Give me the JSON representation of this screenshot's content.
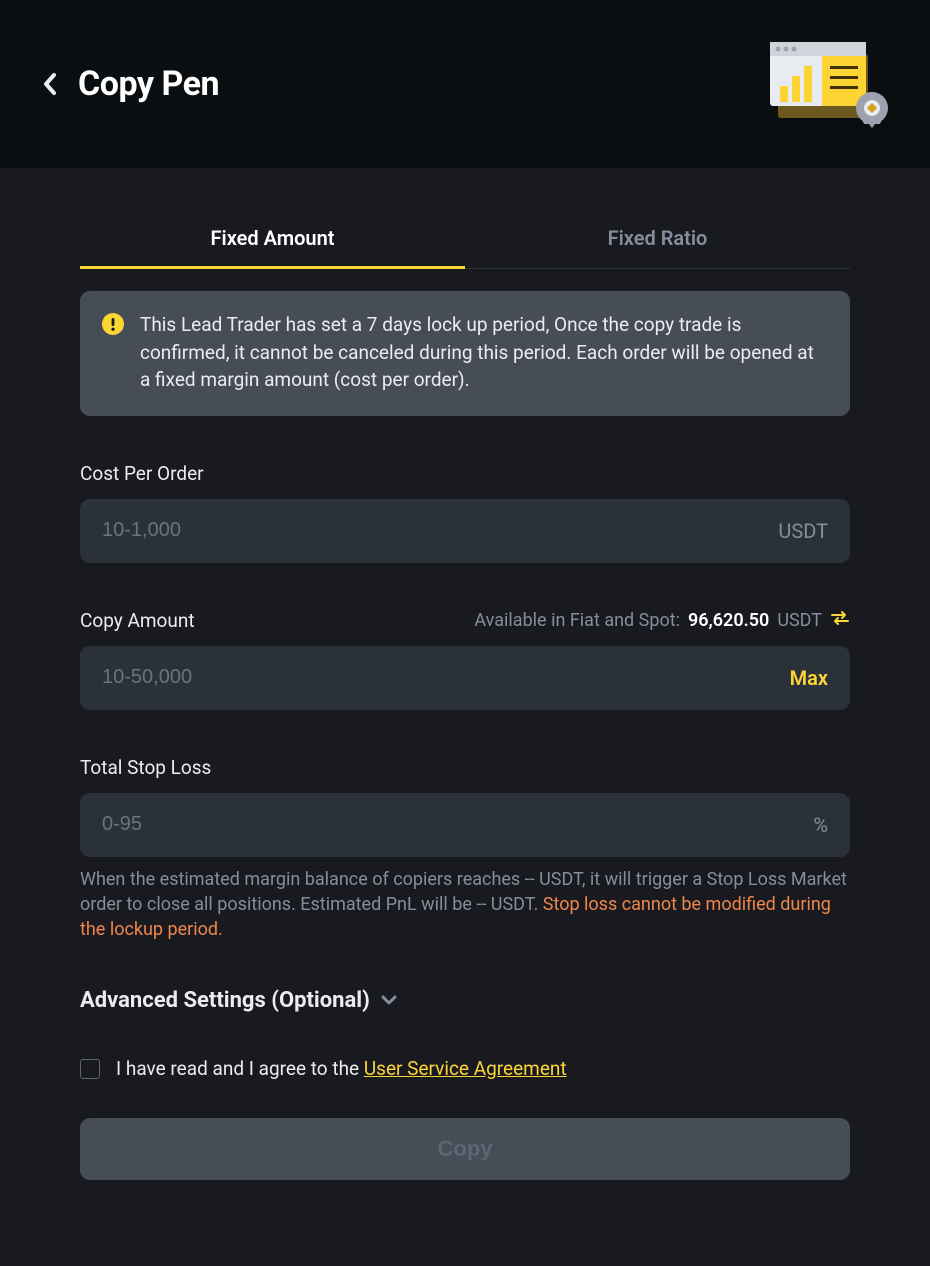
{
  "header": {
    "title": "Copy Pen"
  },
  "tabs": {
    "fixed_amount": "Fixed Amount",
    "fixed_ratio": "Fixed Ratio"
  },
  "notice": {
    "text": "This Lead Trader has set a 7 days lock up period, Once the copy trade is confirmed, it cannot be canceled during this period. Each order will be opened at a fixed margin amount (cost per order)."
  },
  "cost_per_order": {
    "label": "Cost Per Order",
    "placeholder": "10-1,000",
    "suffix": "USDT"
  },
  "copy_amount": {
    "label": "Copy Amount",
    "available_label": "Available in Fiat and Spot:",
    "available_amount": "96,620.50",
    "available_currency": "USDT",
    "placeholder": "10-50,000",
    "max_label": "Max"
  },
  "stop_loss": {
    "label": "Total Stop Loss",
    "placeholder": "0-95",
    "suffix": "%",
    "helper": "When the estimated margin balance of copiers reaches -- USDT, it will trigger a Stop Loss Market order to close all positions. Estimated PnL will be -- USDT.",
    "helper_warning": " Stop loss cannot be modified during the lockup period."
  },
  "advanced": {
    "label": "Advanced Settings (Optional)"
  },
  "agree": {
    "text_prefix": "I have read and I agree to the ",
    "link": "User Service Agreement"
  },
  "copy_button": "Copy"
}
